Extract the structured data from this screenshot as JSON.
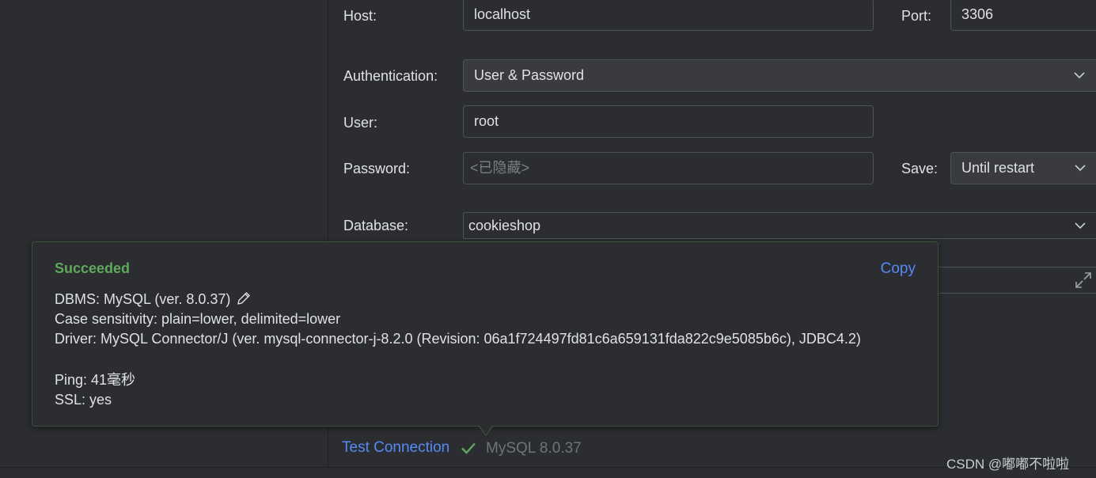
{
  "form": {
    "host_label": "Host:",
    "host_value": "localhost",
    "port_label": "Port:",
    "port_value": "3306",
    "auth_label": "Authentication:",
    "auth_value": "User & Password",
    "user_label": "User:",
    "user_value": "root",
    "password_label": "Password:",
    "password_placeholder": "<已隐藏>",
    "save_label": "Save:",
    "save_value": "Until restart",
    "database_label": "Database:",
    "database_value": "cookieshop"
  },
  "popup": {
    "title": "Succeeded",
    "copy_label": "Copy",
    "lines": {
      "dbms": "DBMS: MySQL (ver. 8.0.37)",
      "case": "Case sensitivity: plain=lower, delimited=lower",
      "driver": "Driver: MySQL Connector/J (ver. mysql-connector-j-8.2.0 (Revision: 06a1f724497fd81c6a659131fda822c9e5085b6c), JDBC4.2)",
      "ping": "Ping: 41毫秒",
      "ssl": "SSL: yes"
    }
  },
  "footer": {
    "test_connection": "Test Connection",
    "server_version": "MySQL 8.0.37"
  },
  "watermark": "CSDN @嘟嘟不啦啦",
  "icons": {
    "dropdown": "chevron-down-icon",
    "expand": "expand-icon",
    "edit": "pencil-icon",
    "success": "checkmark-icon"
  },
  "colors": {
    "success": "#5fa85d",
    "link": "#548af7",
    "background": "#2b2d30",
    "popup_border": "#375239"
  }
}
